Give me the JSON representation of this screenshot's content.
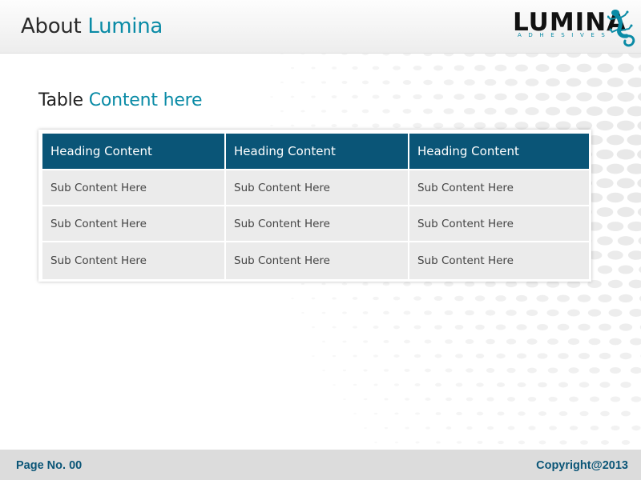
{
  "header": {
    "title_plain": "About ",
    "title_accent": "Lumina",
    "logo": {
      "wordmark": "LUMINA",
      "subtitle": "ADHESIVES",
      "icon": "gecko-icon"
    }
  },
  "main": {
    "title_plain": "Table ",
    "title_accent": "Content here",
    "table": {
      "headers": [
        "Heading Content",
        "Heading Content",
        "Heading Content"
      ],
      "rows": [
        [
          "Sub Content Here",
          "Sub Content Here",
          "Sub Content Here"
        ],
        [
          "Sub Content Here",
          "Sub Content Here",
          "Sub Content Here"
        ],
        [
          "Sub Content Here",
          "Sub Content Here",
          "Sub Content Here"
        ]
      ]
    }
  },
  "footer": {
    "page_label": "Page No. 00",
    "copyright": "Copyright@2013"
  },
  "colors": {
    "accent": "#0a8ba6",
    "header_cell": "#0a5577",
    "body_cell": "#ebebeb",
    "footer_bg": "#dcdcdc",
    "footer_text": "#0a5577"
  }
}
